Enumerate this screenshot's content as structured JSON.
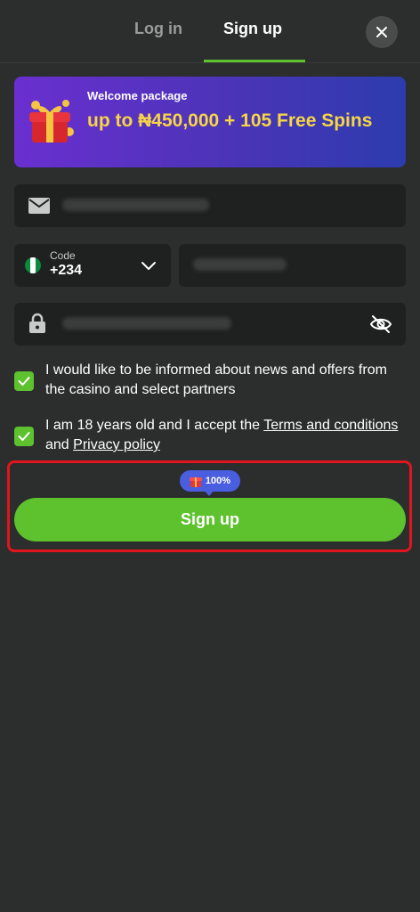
{
  "tabs": {
    "login": "Log in",
    "signup": "Sign up"
  },
  "banner": {
    "small": "Welcome package",
    "big": "up to ₦450,000 + 105 Free Spins"
  },
  "phone": {
    "code_label": "Code",
    "code_value": "+234"
  },
  "checks": {
    "news": "I would like to be informed about news and offers from the casino and select partners",
    "terms_prefix": "I am 18 years old and I accept the ",
    "terms_link": "Terms and conditions",
    "terms_mid": " and ",
    "privacy_link": "Privacy policy"
  },
  "badge": {
    "value": "100%"
  },
  "submit": {
    "label": "Sign up"
  },
  "icons": [
    "close-icon",
    "gift-icon",
    "mail-icon",
    "flag-icon",
    "chevron-down-icon",
    "lock-icon",
    "eye-off-icon",
    "check-icon"
  ],
  "colors": {
    "accent": "#5ec12e",
    "background": "#2c2d2d",
    "field": "#1f2020",
    "banner_text": "#f7d545",
    "badge": "#4a5ee0",
    "highlight": "#e0151d"
  }
}
